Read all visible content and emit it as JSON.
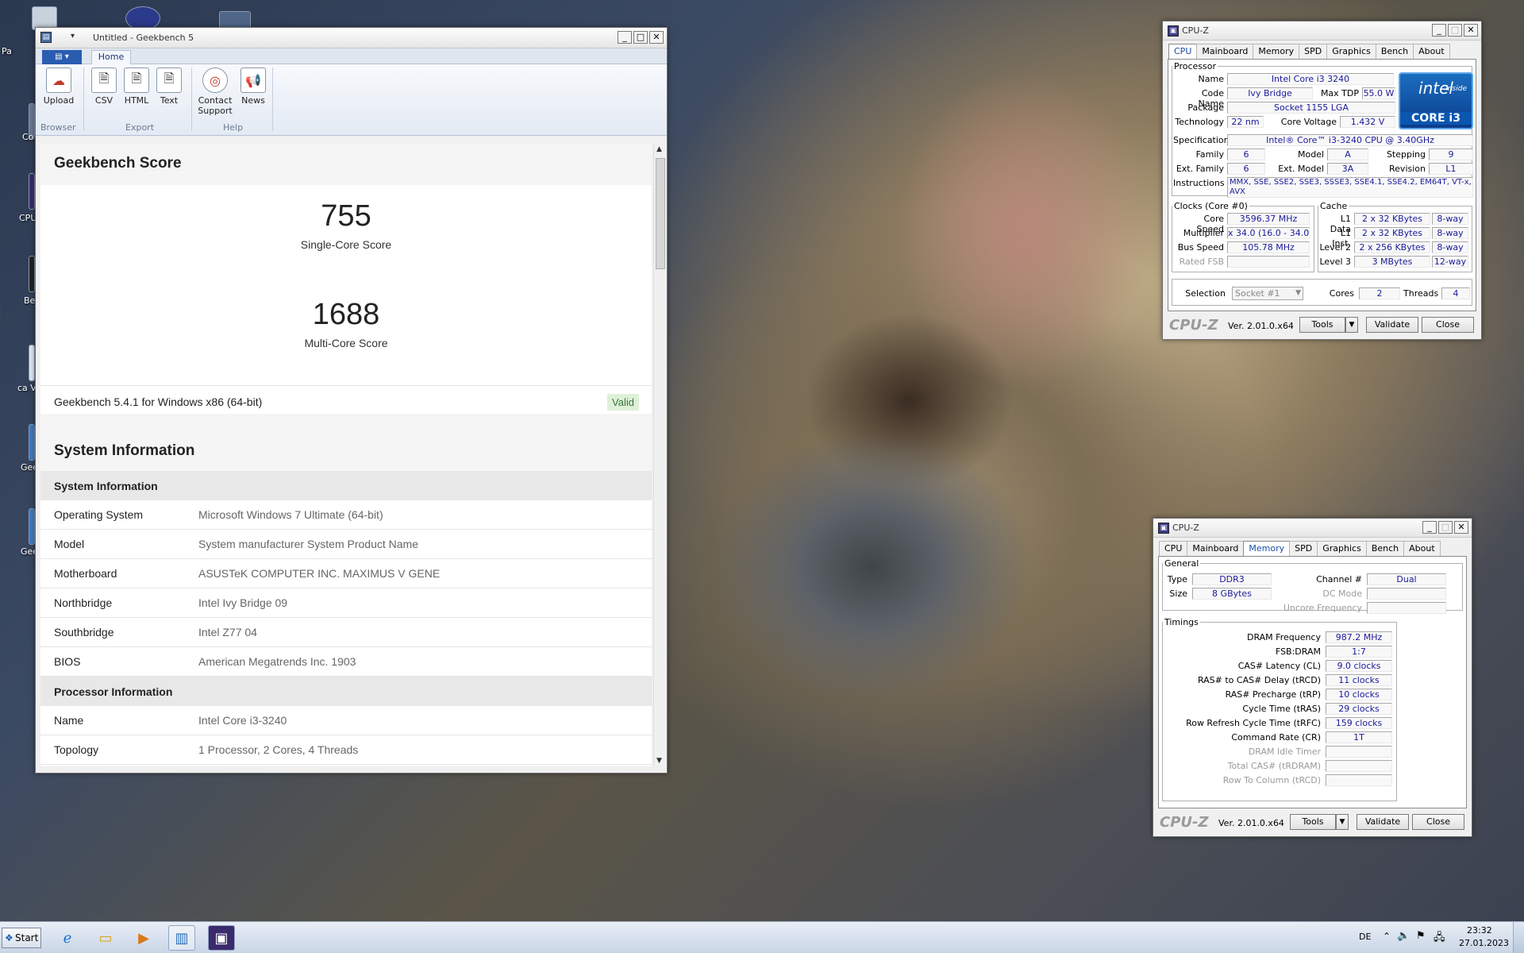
{
  "desktop": {
    "labels": [
      "Pa",
      "Co Veri",
      "CPU",
      "Be",
      "ca Veri",
      "Gee",
      "Gee"
    ]
  },
  "geekbench": {
    "title": "Untitled - Geekbench 5",
    "tab_home": "Home",
    "ribbon": {
      "upload": "Upload",
      "csv": "CSV",
      "html": "HTML",
      "text": "Text",
      "contact_support_1": "Contact",
      "contact_support_2": "Support",
      "news": "News",
      "group_browser": "Browser",
      "group_export": "Export",
      "group_help": "Help"
    },
    "score_heading": "Geekbench Score",
    "single_core_score": "755",
    "single_core_label": "Single-Core Score",
    "multi_core_score": "1688",
    "multi_core_label": "Multi-Core Score",
    "version": "Geekbench 5.4.1 for Windows x86 (64-bit)",
    "valid": "Valid",
    "sysinfo_heading": "System Information",
    "sysinfo_section": "System Information",
    "sysinfo_rows": [
      {
        "k": "Operating System",
        "v": "Microsoft Windows 7 Ultimate (64-bit)"
      },
      {
        "k": "Model",
        "v": "System manufacturer System Product Name"
      },
      {
        "k": "Motherboard",
        "v": "ASUSTeK COMPUTER INC. MAXIMUS V GENE"
      },
      {
        "k": "Northbridge",
        "v": "Intel Ivy Bridge 09"
      },
      {
        "k": "Southbridge",
        "v": "Intel Z77 04"
      },
      {
        "k": "BIOS",
        "v": "American Megatrends Inc. 1903"
      }
    ],
    "procinfo_section": "Processor Information",
    "procinfo_rows": [
      {
        "k": "Name",
        "v": "Intel Core i3-3240"
      },
      {
        "k": "Topology",
        "v": "1 Processor, 2 Cores, 4 Threads"
      }
    ]
  },
  "cpuz1": {
    "title": "CPU-Z",
    "tabs": [
      "CPU",
      "Mainboard",
      "Memory",
      "SPD",
      "Graphics",
      "Bench",
      "About"
    ],
    "processor_legend": "Processor",
    "name_lbl": "Name",
    "name": "Intel Core i3 3240",
    "codename_lbl": "Code Name",
    "codename": "Ivy Bridge",
    "maxtdp_lbl": "Max TDP",
    "maxtdp": "55.0 W",
    "package_lbl": "Package",
    "package": "Socket 1155 LGA",
    "technology_lbl": "Technology",
    "technology": "22 nm",
    "corevoltage_lbl": "Core Voltage",
    "corevoltage": "1.432 V",
    "spec_lbl": "Specification",
    "spec": "Intel® Core™ i3-3240 CPU @ 3.40GHz",
    "family_lbl": "Family",
    "family": "6",
    "model_lbl": "Model",
    "model": "A",
    "stepping_lbl": "Stepping",
    "stepping": "9",
    "extfamily_lbl": "Ext. Family",
    "extfamily": "6",
    "extmodel_lbl": "Ext. Model",
    "extmodel": "3A",
    "revision_lbl": "Revision",
    "revision": "L1",
    "instructions_lbl": "Instructions",
    "instructions": "MMX, SSE, SSE2, SSE3, SSSE3, SSE4.1, SSE4.2, EM64T, VT-x, AVX",
    "intel_logo_top": "intel",
    "intel_logo_inside": "inside",
    "intel_logo_core": "CORE i3",
    "clocks_legend": "Clocks (Core #0)",
    "corespeed_lbl": "Core Speed",
    "corespeed": "3596.37 MHz",
    "multiplier_lbl": "Multiplier",
    "multiplier": "x 34.0 (16.0 - 34.0)",
    "busspeed_lbl": "Bus Speed",
    "busspeed": "105.78 MHz",
    "ratedfsb_lbl": "Rated FSB",
    "cache_legend": "Cache",
    "l1data_lbl": "L1 Data",
    "l1data": "2 x 32 KBytes",
    "l1data_way": "8-way",
    "l1inst_lbl": "L1 Inst.",
    "l1inst": "2 x 32 KBytes",
    "l1inst_way": "8-way",
    "l2_lbl": "Level 2",
    "l2": "2 x 256 KBytes",
    "l2_way": "8-way",
    "l3_lbl": "Level 3",
    "l3": "3 MBytes",
    "l3_way": "12-way",
    "selection_lbl": "Selection",
    "selection": "Socket #1",
    "cores_lbl": "Cores",
    "cores": "2",
    "threads_lbl": "Threads",
    "threads": "4",
    "logo": "CPU-Z",
    "version": "Ver. 2.01.0.x64",
    "tools": "Tools",
    "validate": "Validate",
    "close": "Close"
  },
  "cpuz2": {
    "title": "CPU-Z",
    "tabs": [
      "CPU",
      "Mainboard",
      "Memory",
      "SPD",
      "Graphics",
      "Bench",
      "About"
    ],
    "general_legend": "General",
    "type_lbl": "Type",
    "type": "DDR3",
    "size_lbl": "Size",
    "size": "8 GBytes",
    "channel_lbl": "Channel #",
    "channel": "Dual",
    "dcmode_lbl": "DC Mode",
    "uncore_lbl": "Uncore Frequency",
    "timings_legend": "Timings",
    "timings": [
      {
        "k": "DRAM Frequency",
        "v": "987.2 MHz"
      },
      {
        "k": "FSB:DRAM",
        "v": "1:7"
      },
      {
        "k": "CAS# Latency (CL)",
        "v": "9.0 clocks"
      },
      {
        "k": "RAS# to CAS# Delay (tRCD)",
        "v": "11 clocks"
      },
      {
        "k": "RAS# Precharge (tRP)",
        "v": "10 clocks"
      },
      {
        "k": "Cycle Time (tRAS)",
        "v": "29 clocks"
      },
      {
        "k": "Row Refresh Cycle Time (tRFC)",
        "v": "159 clocks"
      },
      {
        "k": "Command Rate (CR)",
        "v": "1T"
      },
      {
        "k": "DRAM Idle Timer",
        "v": ""
      },
      {
        "k": "Total CAS# (tRDRAM)",
        "v": ""
      },
      {
        "k": "Row To Column (tRCD)",
        "v": ""
      }
    ],
    "logo": "CPU-Z",
    "version": "Ver. 2.01.0.x64",
    "tools": "Tools",
    "validate": "Validate",
    "close": "Close"
  },
  "taskbar": {
    "start": "Start",
    "lang": "DE",
    "time": "23:32",
    "date": "27.01.2023"
  }
}
